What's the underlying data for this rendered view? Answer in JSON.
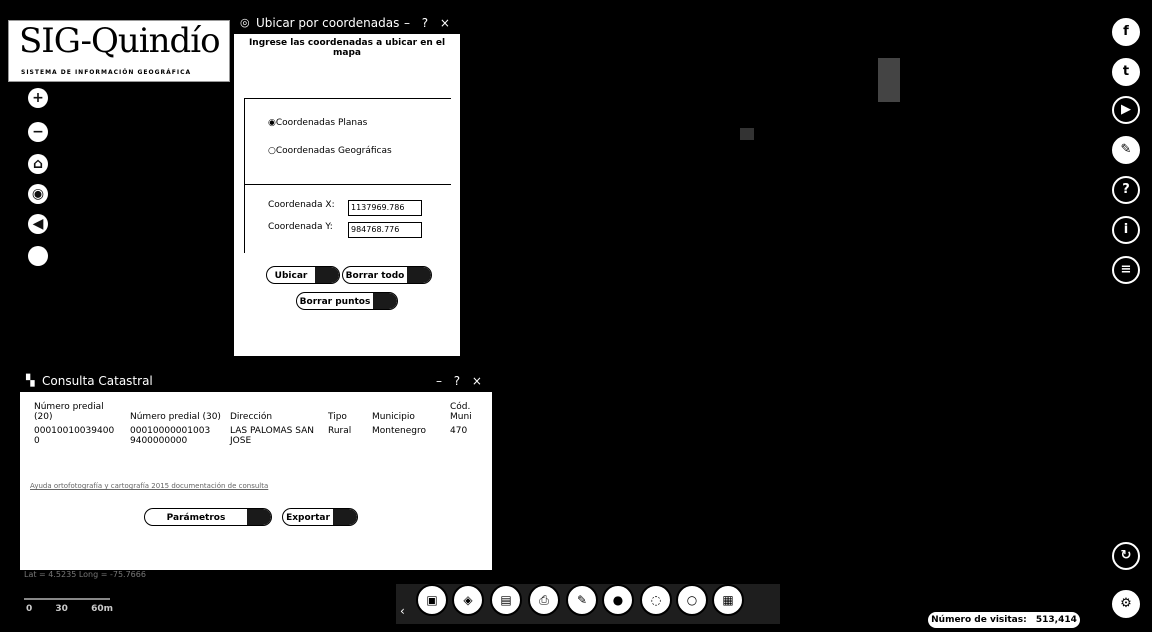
{
  "logo": {
    "title": "SIG-Quindío",
    "subtitle": "SISTEMA DE INFORMACIÓN GEOGRÁFICA"
  },
  "left_controls": [
    {
      "name": "zoom-in",
      "glyph": "+"
    },
    {
      "name": "zoom-out",
      "glyph": "−"
    },
    {
      "name": "home",
      "glyph": "⌂"
    },
    {
      "name": "locate",
      "glyph": "◉"
    },
    {
      "name": "back",
      "glyph": "◀"
    },
    {
      "name": "blank",
      "glyph": ""
    }
  ],
  "coord_panel": {
    "title": "Ubicar por coordenadas",
    "controls": "– ? ×",
    "instruction": "Ingrese las coordenadas a ubicar en el mapa",
    "option_planas": "Coordenadas Planas",
    "option_geograficas": "Coordenadas Geográficas",
    "label_x": "Coordenada X:",
    "label_y": "Coordenada Y:",
    "value_x": "1137969.786",
    "value_y": "984768.776",
    "btn_ubicar": "Ubicar",
    "btn_borrar_todo": "Borrar todo",
    "btn_borrar_puntos": "Borrar puntos"
  },
  "catastral_panel": {
    "title": "Consulta Catastral",
    "controls": "– ? ×",
    "headers": [
      "Número predial (20)",
      "Número predial (30)",
      "Dirección",
      "Tipo",
      "Municipio",
      "Cód. Muni"
    ],
    "row": [
      "00010010039400 0",
      "00010000001003 9400000000",
      "LAS PALOMAS SAN JOSE",
      "Rural",
      "Montenegro",
      "470"
    ],
    "link": "Ayuda ortofotografía y cartografía 2015 documentación de consulta",
    "btn_parametros": "Parámetros consulta",
    "btn_exportar": "Exportar"
  },
  "footer": {
    "coords": "Lat = 4.5235 Long = -75.7666",
    "scale": [
      "0",
      "30",
      "60m"
    ],
    "visitors_label": "Número de visitas:",
    "visitors_count": "513,414"
  },
  "social": [
    {
      "name": "facebook",
      "glyph": "f"
    },
    {
      "name": "twitter",
      "glyph": "t"
    },
    {
      "name": "youtube",
      "glyph": "▶"
    },
    {
      "name": "other",
      "glyph": "✎"
    },
    {
      "name": "help",
      "glyph": "?"
    },
    {
      "name": "info",
      "glyph": "i"
    },
    {
      "name": "list",
      "glyph": "≡"
    }
  ],
  "bottom_tools": [
    {
      "name": "basemap",
      "glyph": "▣"
    },
    {
      "name": "layers",
      "glyph": "◈"
    },
    {
      "name": "identify",
      "glyph": "▤"
    },
    {
      "name": "print",
      "glyph": "⎙"
    },
    {
      "name": "measure",
      "glyph": "✎"
    },
    {
      "name": "location",
      "glyph": "●"
    },
    {
      "name": "search",
      "glyph": "◌"
    },
    {
      "name": "draw",
      "glyph": "○"
    },
    {
      "name": "table",
      "glyph": "▦"
    }
  ]
}
